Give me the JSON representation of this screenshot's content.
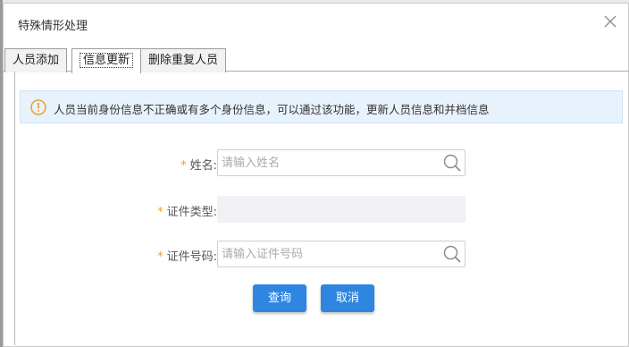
{
  "dialog": {
    "title": "特殊情形处理",
    "close_icon": "close-icon"
  },
  "tabs": [
    {
      "label": "人员添加",
      "active": false
    },
    {
      "label": "信息更新",
      "active": true
    },
    {
      "label": "删除重复人员",
      "active": false
    }
  ],
  "notice": {
    "icon": "warning-circle-icon",
    "text": "人员当前身份信息不正确或有多个身份信息，可以通过该功能，更新人员信息和并档信息"
  },
  "form": {
    "required_mark": "*",
    "name": {
      "label": "姓名:",
      "placeholder": "请输入姓名",
      "value": ""
    },
    "id_type": {
      "label": "证件类型:",
      "value": ""
    },
    "id_number": {
      "label": "证件号码:",
      "placeholder": "请输入证件号码",
      "value": ""
    }
  },
  "buttons": {
    "query": "查询",
    "cancel": "取消"
  },
  "colors": {
    "primary": "#2f86e0",
    "required": "#e6a23c",
    "notice_bg": "#e8f2fc",
    "warning": "#e6a23c"
  }
}
